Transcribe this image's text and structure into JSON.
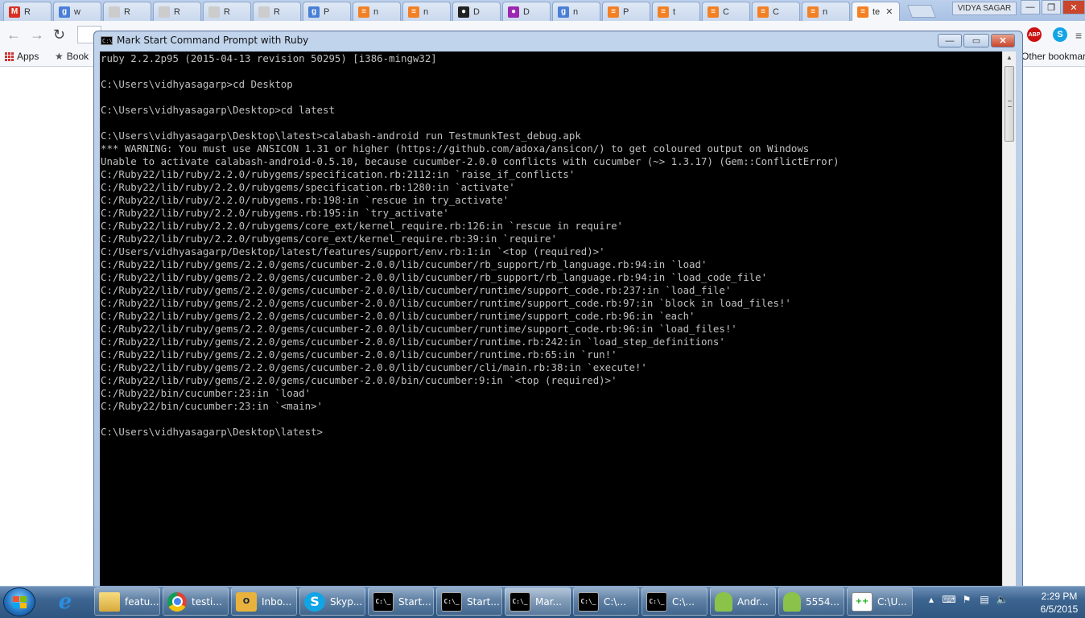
{
  "browser": {
    "tabs": [
      {
        "label": "R",
        "favicon": "gmail-icon",
        "color": "#d93025"
      },
      {
        "label": "w",
        "favicon": "google-plus-icon",
        "color": "#4a7fd6"
      },
      {
        "label": "R",
        "favicon": "blank-page-icon",
        "color": "#cccccc"
      },
      {
        "label": "R",
        "favicon": "blank-page-icon",
        "color": "#cccccc"
      },
      {
        "label": "R",
        "favicon": "blank-page-icon",
        "color": "#cccccc"
      },
      {
        "label": "R",
        "favicon": "blank-page-icon",
        "color": "#cccccc"
      },
      {
        "label": "P",
        "favicon": "google-plus-icon",
        "color": "#4a7fd6"
      },
      {
        "label": "n",
        "favicon": "stackoverflow-icon",
        "color": "#f48024"
      },
      {
        "label": "n",
        "favicon": "stackoverflow-icon",
        "color": "#f48024"
      },
      {
        "label": "D",
        "favicon": "github-icon",
        "color": "#222222"
      },
      {
        "label": "D",
        "favicon": "dots-icon",
        "color": "#9c27b0"
      },
      {
        "label": "n",
        "favicon": "google-plus-icon",
        "color": "#4a7fd6"
      },
      {
        "label": "P",
        "favicon": "stackoverflow-icon",
        "color": "#f48024"
      },
      {
        "label": "t",
        "favicon": "stackoverflow-icon",
        "color": "#f48024"
      },
      {
        "label": "C",
        "favicon": "stackoverflow-icon",
        "color": "#f48024"
      },
      {
        "label": "C",
        "favicon": "stackoverflow-icon",
        "color": "#f48024"
      },
      {
        "label": "n",
        "favicon": "stackoverflow-icon",
        "color": "#f48024"
      },
      {
        "label": "te",
        "favicon": "stackoverflow-icon",
        "color": "#f48024",
        "active": true
      }
    ],
    "profile_name": "VIDYA SAGAR",
    "bookmarks": {
      "apps": "Apps",
      "bookmarks": "Book",
      "other": "Other bookmarks"
    },
    "extensions": {
      "adblock": "ABP",
      "skype": "S"
    }
  },
  "cmd_window": {
    "title": "Mark Start Command Prompt with Ruby",
    "buttons": {
      "minimize": "—",
      "maximize": "▭",
      "close": "✕"
    },
    "lines": [
      "ruby 2.2.2p95 (2015-04-13 revision 50295) [i386-mingw32]",
      "",
      "C:\\Users\\vidhyasagarp>cd Desktop",
      "",
      "C:\\Users\\vidhyasagarp\\Desktop>cd latest",
      "",
      "C:\\Users\\vidhyasagarp\\Desktop\\latest>calabash-android run TestmunkTest_debug.apk",
      "*** WARNING: You must use ANSICON 1.31 or higher (https://github.com/adoxa/ansicon/) to get coloured output on Windows",
      "Unable to activate calabash-android-0.5.10, because cucumber-2.0.0 conflicts with cucumber (~> 1.3.17) (Gem::ConflictError)",
      "C:/Ruby22/lib/ruby/2.2.0/rubygems/specification.rb:2112:in `raise_if_conflicts'",
      "C:/Ruby22/lib/ruby/2.2.0/rubygems/specification.rb:1280:in `activate'",
      "C:/Ruby22/lib/ruby/2.2.0/rubygems.rb:198:in `rescue in try_activate'",
      "C:/Ruby22/lib/ruby/2.2.0/rubygems.rb:195:in `try_activate'",
      "C:/Ruby22/lib/ruby/2.2.0/rubygems/core_ext/kernel_require.rb:126:in `rescue in require'",
      "C:/Ruby22/lib/ruby/2.2.0/rubygems/core_ext/kernel_require.rb:39:in `require'",
      "C:/Users/vidhyasagarp/Desktop/latest/features/support/env.rb:1:in `<top (required)>'",
      "C:/Ruby22/lib/ruby/gems/2.2.0/gems/cucumber-2.0.0/lib/cucumber/rb_support/rb_language.rb:94:in `load'",
      "C:/Ruby22/lib/ruby/gems/2.2.0/gems/cucumber-2.0.0/lib/cucumber/rb_support/rb_language.rb:94:in `load_code_file'",
      "C:/Ruby22/lib/ruby/gems/2.2.0/gems/cucumber-2.0.0/lib/cucumber/runtime/support_code.rb:237:in `load_file'",
      "C:/Ruby22/lib/ruby/gems/2.2.0/gems/cucumber-2.0.0/lib/cucumber/runtime/support_code.rb:97:in `block in load_files!'",
      "C:/Ruby22/lib/ruby/gems/2.2.0/gems/cucumber-2.0.0/lib/cucumber/runtime/support_code.rb:96:in `each'",
      "C:/Ruby22/lib/ruby/gems/2.2.0/gems/cucumber-2.0.0/lib/cucumber/runtime/support_code.rb:96:in `load_files!'",
      "C:/Ruby22/lib/ruby/gems/2.2.0/gems/cucumber-2.0.0/lib/cucumber/runtime.rb:242:in `load_step_definitions'",
      "C:/Ruby22/lib/ruby/gems/2.2.0/gems/cucumber-2.0.0/lib/cucumber/runtime.rb:65:in `run!'",
      "C:/Ruby22/lib/ruby/gems/2.2.0/gems/cucumber-2.0.0/lib/cucumber/cli/main.rb:38:in `execute!'",
      "C:/Ruby22/lib/ruby/gems/2.2.0/gems/cucumber-2.0.0/bin/cucumber:9:in `<top (required)>'",
      "C:/Ruby22/bin/cucumber:23:in `load'",
      "C:/Ruby22/bin/cucumber:23:in `<main>'",
      "",
      "C:\\Users\\vidhyasagarp\\Desktop\\latest>"
    ]
  },
  "taskbar": {
    "items": [
      {
        "label": "",
        "icon": "internet-explorer-icon",
        "kind": "pin"
      },
      {
        "label": "featu...",
        "icon": "folder-icon",
        "kind": "app"
      },
      {
        "label": "testi...",
        "icon": "chrome-icon",
        "kind": "app"
      },
      {
        "label": "Inbo...",
        "icon": "outlook-icon",
        "kind": "app"
      },
      {
        "label": "Skyp...",
        "icon": "skype-icon",
        "kind": "app"
      },
      {
        "label": "Start...",
        "icon": "cmd-icon",
        "kind": "app"
      },
      {
        "label": "Start...",
        "icon": "cmd-icon",
        "kind": "app"
      },
      {
        "label": "Mar...",
        "icon": "cmd-icon",
        "kind": "app",
        "active": true
      },
      {
        "label": "C:\\...",
        "icon": "cmd-icon",
        "kind": "app"
      },
      {
        "label": "C:\\...",
        "icon": "cmd-icon",
        "kind": "app"
      },
      {
        "label": "Andr...",
        "icon": "android-sdk-icon",
        "kind": "app"
      },
      {
        "label": "5554...",
        "icon": "android-emulator-icon",
        "kind": "app"
      },
      {
        "label": "C:\\U...",
        "icon": "notepad-plus-icon",
        "kind": "app"
      }
    ],
    "clock": {
      "time": "2:29 PM",
      "date": "6/5/2015"
    }
  }
}
